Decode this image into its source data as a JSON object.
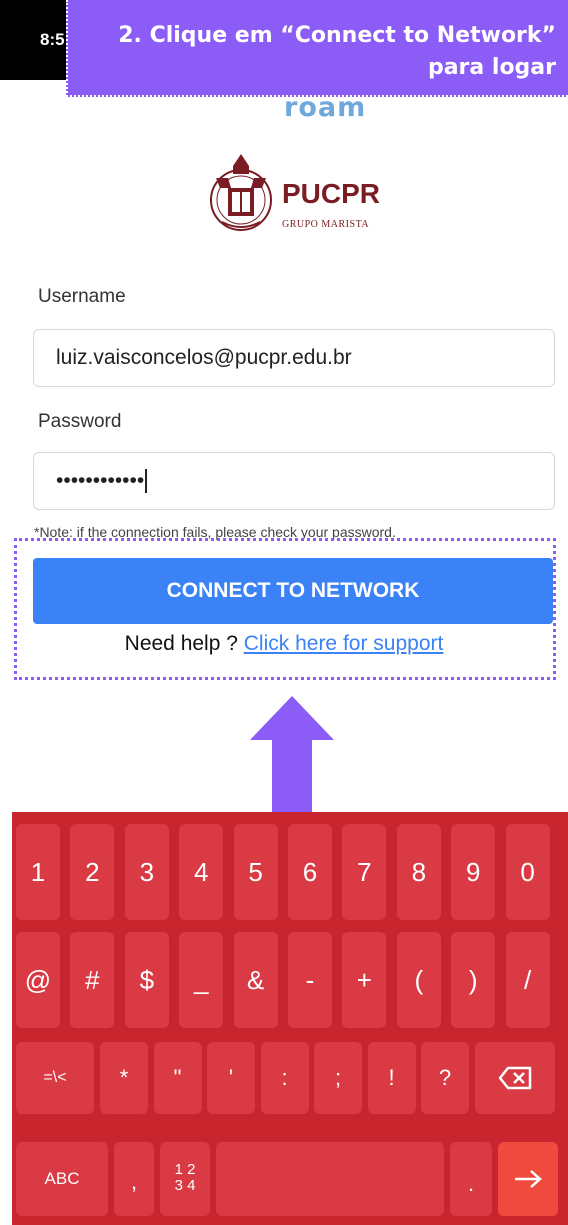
{
  "status_bar": {
    "time": "8:5"
  },
  "callout": {
    "line1": "2. Clique em “Connect to Network”",
    "line2": "para logar"
  },
  "header": {
    "brand_fragment": "roam"
  },
  "logo": {
    "name": "PUCPR",
    "subtitle": "GRUPO MARISTA"
  },
  "form": {
    "username_label": "Username",
    "username_value": "luiz.vaisconcelos@pucpr.edu.br",
    "password_label": "Password",
    "password_value": "••••••••••••",
    "note": "*Note: if the connection fails, please check your password.",
    "connect_label": "CONNECT TO NETWORK",
    "help_prefix": "Need help ? ",
    "help_link": "Click here for support"
  },
  "keyboard": {
    "row1": [
      "1",
      "2",
      "3",
      "4",
      "5",
      "6",
      "7",
      "8",
      "9",
      "0"
    ],
    "row2": [
      "@",
      "#",
      "$",
      "_",
      "&",
      "-",
      "+",
      "(",
      ")",
      "/"
    ],
    "row3": [
      "=\\<",
      "*",
      "\"",
      "'",
      ":",
      ";",
      "!",
      "?"
    ],
    "backspace_icon": "backspace-icon",
    "abc": "ABC",
    "comma": ",",
    "numpad_top": "1 2",
    "numpad_bottom": "3 4",
    "period": ".",
    "enter_icon": "arrow-right-icon"
  },
  "colors": {
    "callout": "#8b5cf6",
    "button": "#3b82f6",
    "keyboard": "#c8252f",
    "logo": "#7a1c24"
  }
}
